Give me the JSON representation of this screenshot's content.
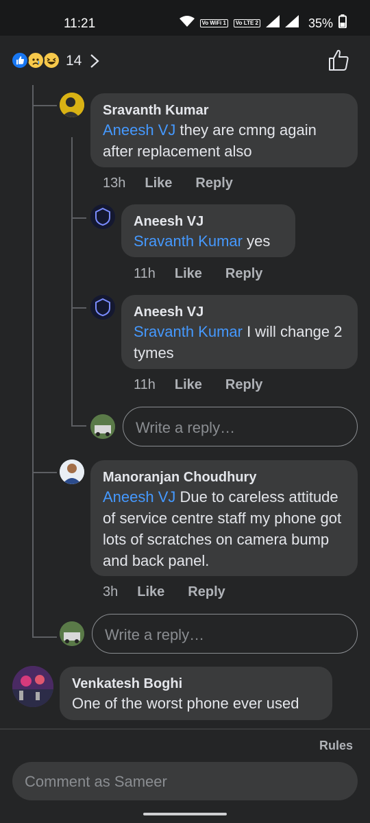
{
  "status_bar": {
    "time": "11:21",
    "wifi_label": "Vo WiFi 1",
    "lte_label": "Vo LTE 2",
    "battery": "35%"
  },
  "header": {
    "reaction_count": "14",
    "reactions": [
      "like-icon",
      "sad-icon",
      "haha-icon"
    ]
  },
  "comments": [
    {
      "author": "Sravanth Kumar",
      "mention": "Aneesh VJ",
      "text": " they are cmng again after replacement also",
      "time": "13h",
      "like": "Like",
      "reply": "Reply"
    },
    {
      "author": "Aneesh VJ",
      "mention": "Sravanth Kumar",
      "text": " yes",
      "time": "11h",
      "like": "Like",
      "reply": "Reply"
    },
    {
      "author": "Aneesh VJ",
      "mention": "Sravanth Kumar",
      "text": " I will change 2 tymes",
      "time": "11h",
      "like": "Like",
      "reply": "Reply"
    },
    {
      "author": "Manoranjan Choudhury",
      "mention": "Aneesh VJ",
      "text": " Due to careless attitude of service centre staff my phone got lots of scratches on camera bump and back panel.",
      "time": "3h",
      "like": "Like",
      "reply": "Reply"
    },
    {
      "author": "Venkatesh Boghi",
      "text": "One of the worst phone ever used"
    }
  ],
  "reply_placeholder": "Write a reply…",
  "footer": {
    "rules": "Rules",
    "comment_placeholder": "Comment as Sameer"
  },
  "colors": {
    "background": "#242526",
    "bubble": "#3a3b3c",
    "mention": "#4599ff",
    "muted": "#b0b3b8"
  }
}
